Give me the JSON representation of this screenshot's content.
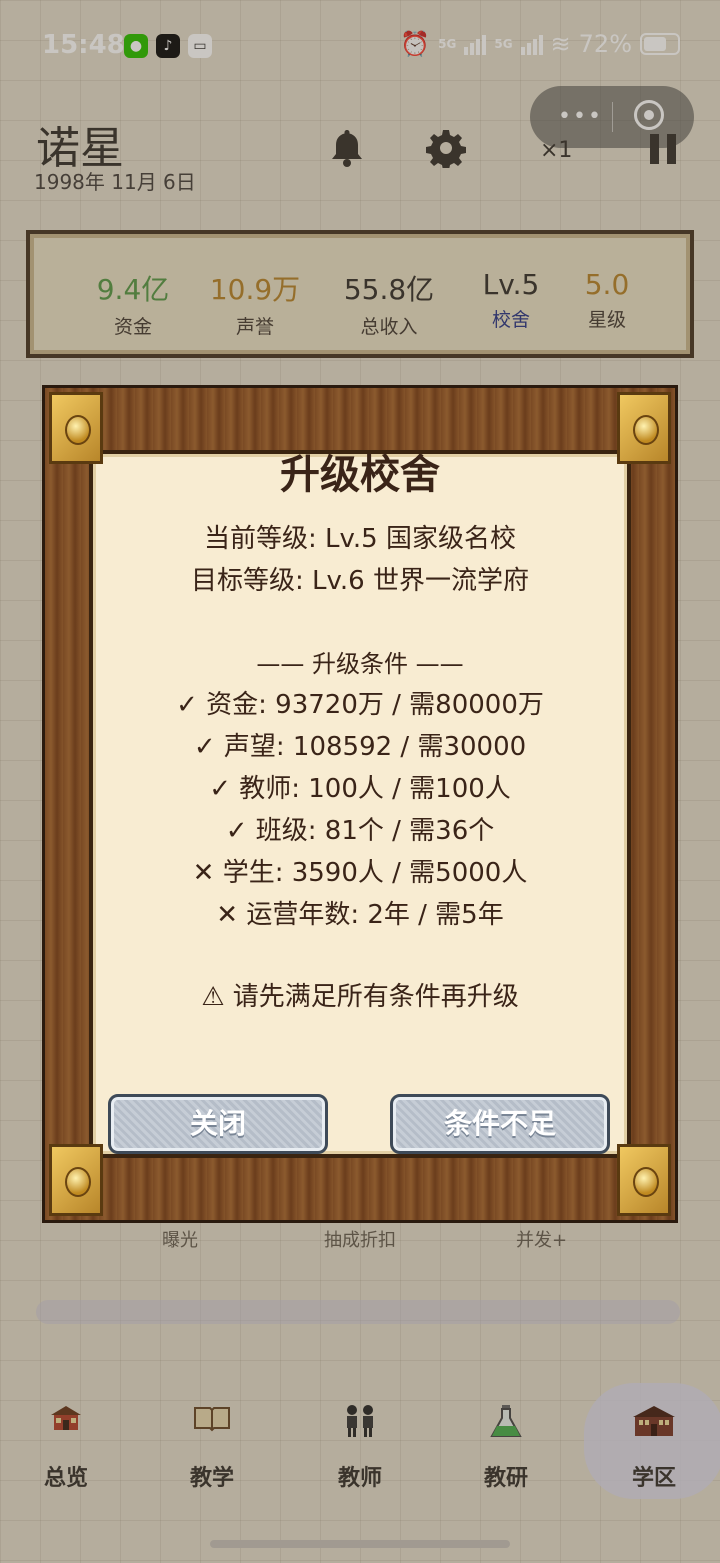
{
  "status_bar": {
    "time": "15:48",
    "network_1": "5G",
    "network_2": "5G",
    "battery": "72%",
    "battery_level": 0.72,
    "app_icons": [
      "wechat-icon",
      "tiktok-icon",
      "message-icon"
    ]
  },
  "header": {
    "school_name": "诺星",
    "date": "1998年 11月 6日",
    "speed": "×1"
  },
  "stats": [
    {
      "value": "9.4亿",
      "label": "资金",
      "color": "#5a9a4a"
    },
    {
      "value": "10.9万",
      "label": "声誉",
      "color": "#b8862e"
    },
    {
      "value": "55.8亿",
      "label": "总收入",
      "color": "#3a3530"
    },
    {
      "value": "Lv.5",
      "label": "校舍",
      "color": "#3a3530"
    },
    {
      "value": "5.0",
      "label": "星级",
      "color": "#b8862e"
    }
  ],
  "modal": {
    "title": "升级校舍",
    "current_level": "当前等级: Lv.5 国家级名校",
    "target_level": "目标等级: Lv.6 世界一流学府",
    "conditions_heading": "—— 升级条件 ——",
    "conditions": [
      {
        "text": "✓ 资金: 93720万 / 需80000万",
        "met": true
      },
      {
        "text": "✓ 声望: 108592 / 需30000",
        "met": true
      },
      {
        "text": "✓ 教师: 100人 / 需100人",
        "met": true
      },
      {
        "text": "✓ 班级: 81个 / 需36个",
        "met": true
      },
      {
        "text": "✕ 学生: 3590人 / 需5000人",
        "met": false
      },
      {
        "text": "✕ 运营年数: 2年 / 需5年",
        "met": false
      }
    ],
    "warning": "⚠ 请先满足所有条件再升级",
    "close_button": "关闭",
    "upgrade_button": "条件不足"
  },
  "background": {
    "labels": [
      "曝光",
      "抽成折扣",
      "并发+"
    ]
  },
  "nav": {
    "items": [
      {
        "label": "总览",
        "icon": "school-house-icon"
      },
      {
        "label": "教学",
        "icon": "book-icon"
      },
      {
        "label": "教师",
        "icon": "teachers-icon"
      },
      {
        "label": "教研",
        "icon": "flask-icon"
      },
      {
        "label": "学区",
        "icon": "campus-building-icon"
      }
    ],
    "active": "学区"
  }
}
